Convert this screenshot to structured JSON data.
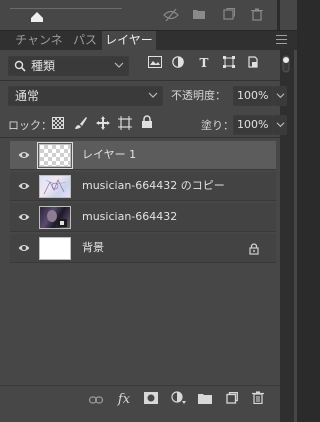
{
  "tabs": [
    {
      "label": "チャンネル"
    },
    {
      "label": "パス"
    },
    {
      "label": "レイヤー"
    }
  ],
  "filter": {
    "kind_label": "種類"
  },
  "blend": {
    "mode": "通常",
    "opacity_label": "不透明度：",
    "opacity_value": "100%"
  },
  "lock": {
    "label": "ロック：",
    "fill_label": "塗り：",
    "fill_value": "100%"
  },
  "layers": [
    {
      "name": "レイヤー 1"
    },
    {
      "name": "musician-664432 のコピー"
    },
    {
      "name": "musician-664432"
    },
    {
      "name": "背景"
    }
  ],
  "bottom": {
    "fx_label": "fx"
  }
}
